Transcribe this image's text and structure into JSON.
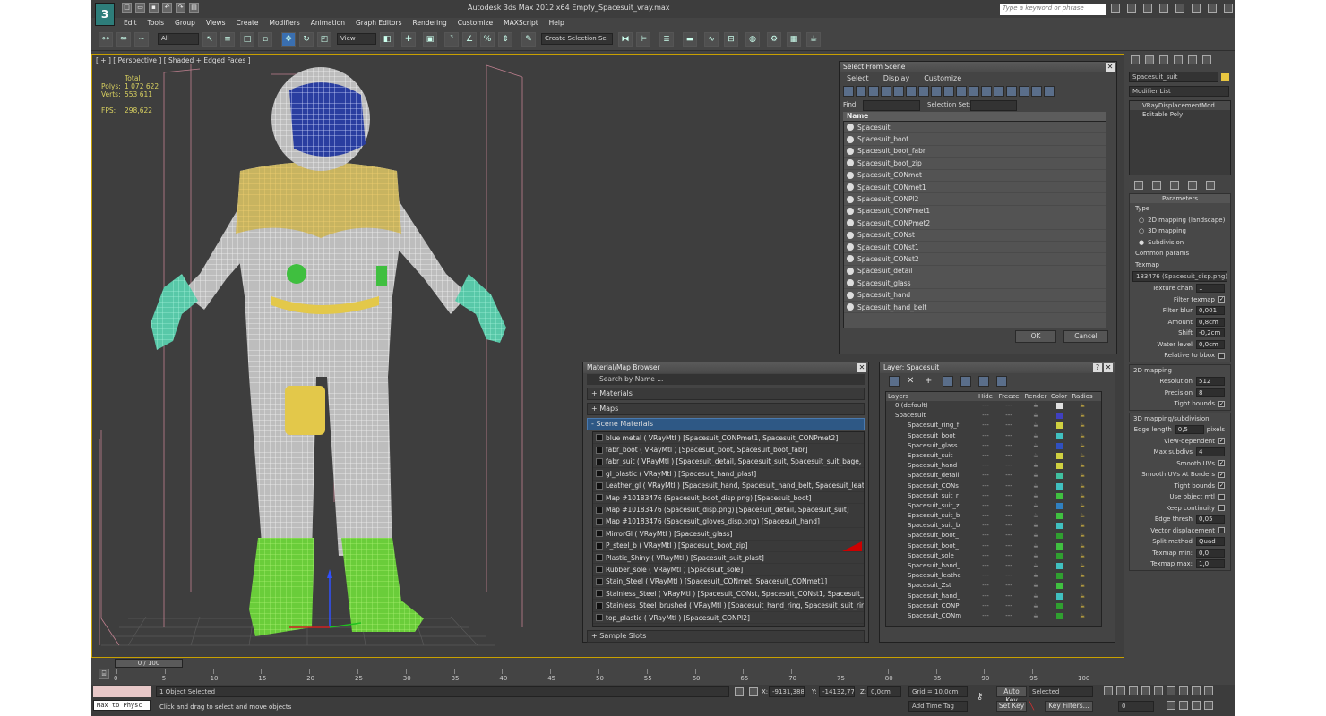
{
  "app": {
    "title": "Autodesk 3ds Max  2012 x64     Empty_Spacesuit_vray.max",
    "logo": "3",
    "search_placeholder": "Type a keyword or phrase"
  },
  "menus": [
    "Edit",
    "Tools",
    "Group",
    "Views",
    "Create",
    "Modifiers",
    "Animation",
    "Graph Editors",
    "Rendering",
    "Customize",
    "MAXScript",
    "Help"
  ],
  "toolbar": {
    "filter_value": "All",
    "view_value": "View",
    "selection_set_placeholder": "Create Selection Se"
  },
  "viewport": {
    "label": "[ + ] [ Perspective ] [ Shaded + Edged Faces ]",
    "stats": {
      "total_label": "Total",
      "polys_label": "Polys:",
      "polys_value": "1 072 622",
      "verts_label": "Verts:",
      "verts_value": "553 611",
      "fps_label": "FPS:",
      "fps_value": "298,622"
    }
  },
  "select_from_scene": {
    "title": "Select From Scene",
    "menu": [
      "Select",
      "Display",
      "Customize"
    ],
    "find_label": "Find:",
    "selection_set_label": "Selection Set:",
    "column_name": "Name",
    "items": [
      "Spacesuit",
      "Spacesuit_boot",
      "Spacesuit_boot_fabr",
      "Spacesuit_boot_zip",
      "Spacesuit_CONmet",
      "Spacesuit_CONmet1",
      "Spacesuit_CONPl2",
      "Spacesuit_CONPmet1",
      "Spacesuit_CONPmet2",
      "Spacesuit_CONst",
      "Spacesuit_CONst1",
      "Spacesuit_CONst2",
      "Spacesuit_detail",
      "Spacesuit_glass",
      "Spacesuit_hand",
      "Spacesuit_hand_belt"
    ],
    "ok": "OK",
    "cancel": "Cancel"
  },
  "material_browser": {
    "title": "Material/Map Browser",
    "search_placeholder": "Search by Name ...",
    "groups": {
      "materials": "+ Materials",
      "maps": "+ Maps",
      "scene": "- Scene Materials",
      "samples": "+ Sample Slots"
    },
    "scene_materials": [
      "blue metal  ( VRayMtl ) [Spacesuit_CONPmet1, Spacesuit_CONPmet2]",
      "fabr_boot  ( VRayMtl ) [Spacesuit_boot, Spacesuit_boot_fabr]",
      "fabr_suit  ( VRayMtl ) [Spacesuit_detail, Spacesuit_suit, Spacesuit_suit_bage, Sp...",
      "gl_plastic  ( VRayMtl ) [Spacesuit_hand_plast]",
      "Leather_gl  ( VRayMtl ) [Spacesuit_hand, Spacesuit_hand_belt, Spacesuit_leathe...",
      "Map #10183476 (Spacesuit_boot_disp.png) [Spacesuit_boot]",
      "Map #10183476 (Spacesuit_disp.png) [Spacesuit_detail, Spacesuit_suit]",
      "Map #10183476 (Spacesuit_gloves_disp.png) [Spacesuit_hand]",
      "MirrorGl  ( VRayMtl ) [Spacesuit_glass]",
      "P_steel_b  ( VRayMtl ) [Spacesuit_boot_zip]",
      "Plastic_Shiny  ( VRayMtl ) [Spacesuit_suit_plast]",
      "Rubber_sole  ( VRayMtl ) [Spacesuit_sole]",
      "Stain_Steel  ( VRayMtl ) [Spacesuit_CONmet, Spacesuit_CONmet1]",
      "Stainless_Steel  ( VRayMtl ) [Spacesuit_CONst, Spacesuit_CONst1, Spacesuit_CO...",
      "Stainless_Steel_brushed  ( VRayMtl ) [Spacesuit_hand_ring, Spacesuit_suit_ring,...",
      "top_plastic  ( VRayMtl ) [Spacesuit_CONPl2]"
    ]
  },
  "layer_manager": {
    "title": "Layer: Spacesuit",
    "columns": [
      "Layers",
      "Hide",
      "Freeze",
      "Render",
      "Color",
      "Radios"
    ],
    "rows": [
      {
        "name": "0 (default)",
        "color": "#e0e0e0"
      },
      {
        "name": "Spacesuit",
        "color": "#4040c0"
      },
      {
        "name": "Spacesuit_ring_f",
        "color": "#d0d040"
      },
      {
        "name": "Spacesuit_boot",
        "color": "#40c0c0"
      },
      {
        "name": "Spacesuit_glass",
        "color": "#3050c0"
      },
      {
        "name": "Spacesuit_suit",
        "color": "#d0d040"
      },
      {
        "name": "Spacesuit_hand",
        "color": "#d0d040"
      },
      {
        "name": "Spacesuit_detail",
        "color": "#40c0a0"
      },
      {
        "name": "Spacesuit_CONs",
        "color": "#40c0c0"
      },
      {
        "name": "Spacesuit_suit_r",
        "color": "#40c040"
      },
      {
        "name": "Spacesuit_suit_z",
        "color": "#3080c0"
      },
      {
        "name": "Spacesuit_suit_b",
        "color": "#40c040"
      },
      {
        "name": "Spacesuit_suit_b",
        "color": "#40c0c0"
      },
      {
        "name": "Spacesuit_boot_",
        "color": "#30a030"
      },
      {
        "name": "Spacesuit_boot_",
        "color": "#40c040"
      },
      {
        "name": "Spacesuit_sole",
        "color": "#30a030"
      },
      {
        "name": "Spacesuit_hand_",
        "color": "#40c0c0"
      },
      {
        "name": "Spacesuit_leathe",
        "color": "#30a030"
      },
      {
        "name": "Spacesuit_Zst",
        "color": "#40c040"
      },
      {
        "name": "Spacesuit_hand_",
        "color": "#40c0c0"
      },
      {
        "name": "Spacesuit_CONP",
        "color": "#30a030"
      },
      {
        "name": "Spacesuit_CONm",
        "color": "#30a030"
      }
    ]
  },
  "command_panel": {
    "object_name": "Spacesuit_suit",
    "modifier_list": "Modifier List",
    "stack": [
      "VRayDisplacementMod",
      "Editable Poly"
    ],
    "parameters_title": "Parameters",
    "type_label": "Type",
    "type_options": [
      "2D mapping (landscape)",
      "3D mapping",
      "Subdivision"
    ],
    "common_params": "Common params",
    "texmap_label": "Texmap",
    "texmap_value": "183476 (Spacesuit_disp.png)",
    "params": [
      {
        "label": "Texture chan",
        "value": "1"
      },
      {
        "label": "Filter texmap",
        "check": "✓"
      },
      {
        "label": "Filter blur",
        "value": "0,001"
      },
      {
        "label": "Amount",
        "value": "0,8cm"
      },
      {
        "label": "Shift",
        "value": "-0,2cm"
      },
      {
        "label": "Water level",
        "value": "0,0cm"
      },
      {
        "label": "Relative to bbox",
        "check": ""
      }
    ],
    "mapping2d_title": "2D mapping",
    "mapping2d": [
      {
        "label": "Resolution",
        "value": "512"
      },
      {
        "label": "Precision",
        "value": "8"
      },
      {
        "label": "Tight bounds",
        "check": "✓"
      }
    ],
    "mapping3d_title": "3D mapping/subdivision",
    "mapping3d": [
      {
        "label": "Edge length",
        "value": "0,5",
        "suffix": "pixels"
      },
      {
        "label": "View-dependent",
        "check": "✓"
      },
      {
        "label": "Max subdivs",
        "value": "4"
      },
      {
        "label": "Smooth UVs",
        "check": "✓"
      },
      {
        "label": "Smooth UVs At Borders",
        "check": "✓"
      },
      {
        "label": "Tight bounds",
        "check": "✓"
      },
      {
        "label": "Use object mtl",
        "check": ""
      },
      {
        "label": "Keep continuity",
        "check": ""
      },
      {
        "label": "Edge thresh",
        "value": "0,05"
      },
      {
        "label": "Vector displacement",
        "check": ""
      },
      {
        "label": "Split method",
        "value": "Quad"
      },
      {
        "label": "Texmap min:",
        "value": "0,0"
      },
      {
        "label": "Texmap max:",
        "value": "1,0"
      }
    ]
  },
  "timeline": {
    "frame_label": "0 / 100",
    "ticks": [
      "0",
      "5",
      "10",
      "15",
      "20",
      "25",
      "30",
      "35",
      "40",
      "45",
      "50",
      "55",
      "60",
      "65",
      "70",
      "75",
      "80",
      "85",
      "90",
      "95",
      "100"
    ]
  },
  "status": {
    "maxscript": "Max to Physc",
    "selected": "1 Object Selected",
    "hint": "Click and drag to select and move objects",
    "x_label": "X:",
    "x_value": "-9131,388c",
    "y_label": "Y:",
    "y_value": "-14132,77",
    "z_label": "Z:",
    "z_value": "0,0cm",
    "grid": "Grid = 10,0cm",
    "add_time_tag": "Add Time Tag",
    "auto_key": "Auto Key",
    "selected_dropdown": "Selected",
    "set_key": "Set Key",
    "key_filters": "Key Filters...",
    "frame": "0"
  }
}
